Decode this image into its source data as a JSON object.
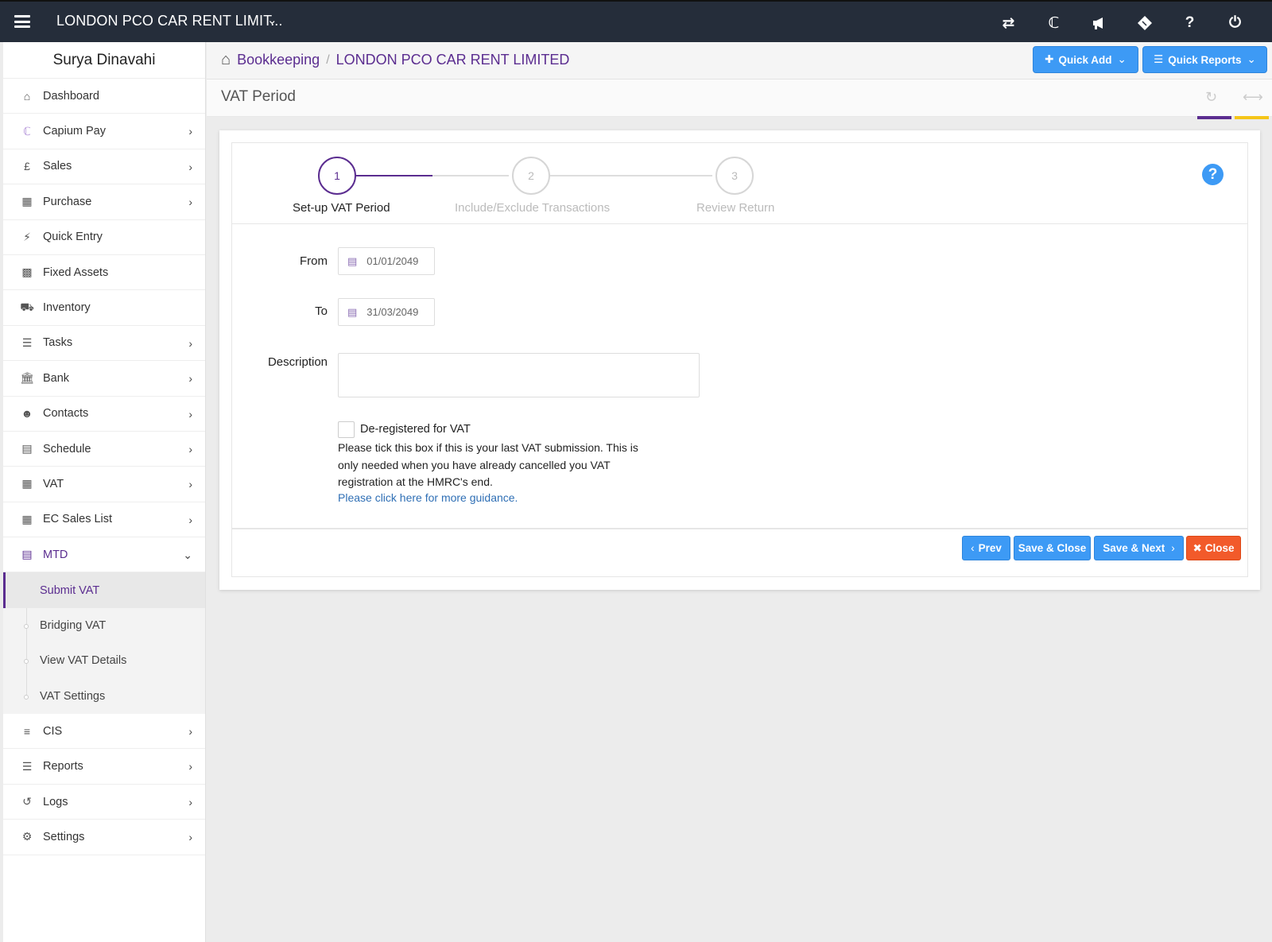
{
  "topbar": {
    "company": "LONDON PCO CAR RENT LIMIT...",
    "icons": [
      "transfer-icon",
      "capium-icon",
      "megaphone-icon",
      "ticket-icon",
      "help-icon",
      "power-icon"
    ]
  },
  "sidebar": {
    "user": "Surya Dinavahi",
    "items": [
      {
        "label": "Dashboard",
        "icon": "home-icon"
      },
      {
        "label": "Capium Pay",
        "icon": "capium-pay-icon"
      },
      {
        "label": "Sales",
        "icon": "pound-icon"
      },
      {
        "label": "Purchase",
        "icon": "qr-icon"
      },
      {
        "label": "Quick Entry",
        "icon": "bolt-icon"
      },
      {
        "label": "Fixed Assets",
        "icon": "building-icon"
      },
      {
        "label": "Inventory",
        "icon": "truck-icon"
      },
      {
        "label": "Tasks",
        "icon": "tasks-icon"
      },
      {
        "label": "Bank",
        "icon": "bank-icon"
      },
      {
        "label": "Contacts",
        "icon": "users-icon"
      },
      {
        "label": "Schedule",
        "icon": "calendar-icon"
      },
      {
        "label": "VAT",
        "icon": "calculator-icon"
      },
      {
        "label": "EC Sales List",
        "icon": "calculator-icon"
      },
      {
        "label": "MTD",
        "icon": "calendar-icon"
      }
    ],
    "sub_items": [
      {
        "label": "Submit VAT"
      },
      {
        "label": "Bridging VAT"
      },
      {
        "label": "View VAT Details"
      },
      {
        "label": "VAT Settings"
      }
    ],
    "bottom_items": [
      {
        "label": "CIS",
        "icon": "indent-icon"
      },
      {
        "label": "Reports",
        "icon": "list-icon"
      },
      {
        "label": "Logs",
        "icon": "history-icon"
      },
      {
        "label": "Settings",
        "icon": "cogs-icon"
      }
    ]
  },
  "header": {
    "crumb_root": "Bookkeeping",
    "crumb_sep": "/",
    "crumb_current": "LONDON PCO CAR RENT LIMITED",
    "quick_add": "Quick Add",
    "quick_reports": "Quick Reports"
  },
  "page": {
    "title": "VAT Period"
  },
  "wizard": {
    "steps": [
      {
        "num": "1",
        "label": "Set-up VAT Period",
        "active": true
      },
      {
        "num": "2",
        "label": "Include/Exclude Transactions",
        "active": false
      },
      {
        "num": "3",
        "label": "Review Return",
        "active": false
      }
    ]
  },
  "form": {
    "from_label": "From",
    "from_value": "01/01/2049",
    "to_label": "To",
    "to_value": "31/03/2049",
    "description_label": "Description",
    "description_value": "",
    "deregistered_label": "De-registered for VAT",
    "deregistered_checked": false,
    "deregistered_help": "Please tick this box if this is your last VAT submission. This is only needed when you have already cancelled you VAT registration at the HMRC's end.",
    "guidance_link": "Please click here for more guidance."
  },
  "footer": {
    "prev": "Prev",
    "save_close": "Save & Close",
    "save_next": "Save & Next",
    "close": "Close"
  },
  "colors": {
    "topbar": "#252d3a",
    "brand_purple": "#5b2d90",
    "button_blue": "#3d9af5",
    "button_red": "#f25a2a",
    "accent_yellow": "#f5c518"
  }
}
